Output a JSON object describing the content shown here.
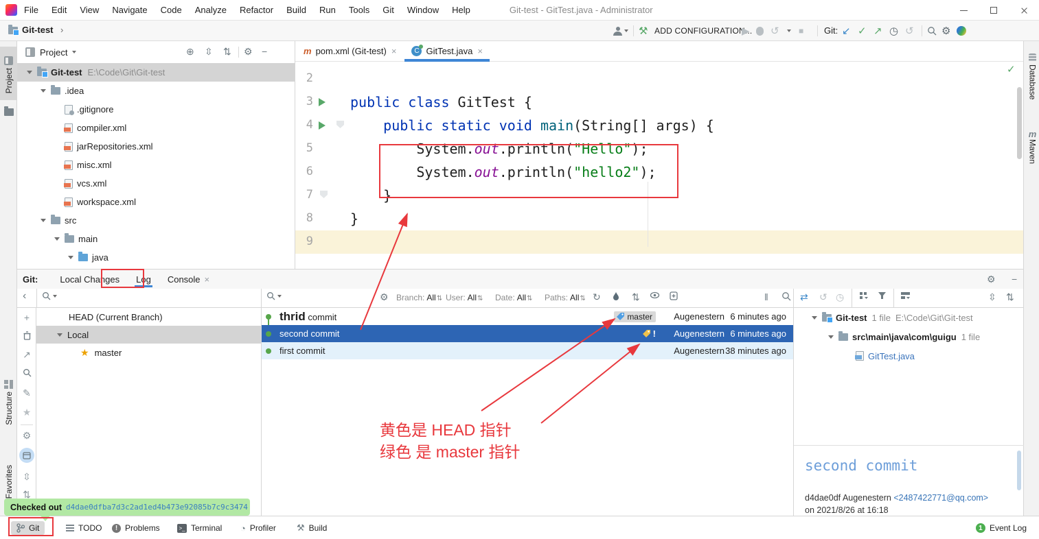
{
  "title_bar": {
    "menu": [
      "File",
      "Edit",
      "View",
      "Navigate",
      "Code",
      "Analyze",
      "Refactor",
      "Build",
      "Run",
      "Tools",
      "Git",
      "Window",
      "Help"
    ],
    "title": "Git-test - GitTest.java - Administrator"
  },
  "toolbar": {
    "breadcrumb": "Git-test",
    "breadcrumb_sep": "›",
    "add_configuration": "ADD CONFIGURATION...",
    "git_label": "Git:"
  },
  "stripes": {
    "project": "Project",
    "structure": "Structure",
    "favorites": "Favorites",
    "database": "Database",
    "maven": "Maven",
    "maven_glyph": "m"
  },
  "project_panel": {
    "header": "Project",
    "tree": [
      {
        "label": "Git-test",
        "suffix": "E:\\Code\\Git\\Git-test",
        "level": 0,
        "icon": "project",
        "caret": true,
        "bold": true,
        "selected": true
      },
      {
        "label": ".idea",
        "level": 1,
        "icon": "folder",
        "caret": true
      },
      {
        "label": ".gitignore",
        "level": 2,
        "icon": "ignored"
      },
      {
        "label": "compiler.xml",
        "level": 2,
        "icon": "xml"
      },
      {
        "label": "jarRepositories.xml",
        "level": 2,
        "icon": "xml"
      },
      {
        "label": "misc.xml",
        "level": 2,
        "icon": "xml"
      },
      {
        "label": "vcs.xml",
        "level": 2,
        "icon": "xml"
      },
      {
        "label": "workspace.xml",
        "level": 2,
        "icon": "xml"
      },
      {
        "label": "src",
        "level": 1,
        "icon": "folder",
        "caret": true
      },
      {
        "label": "main",
        "level": 2,
        "icon": "folder",
        "caret": true
      },
      {
        "label": "java",
        "level": 3,
        "icon": "folder-java",
        "caret": true
      }
    ]
  },
  "editor": {
    "tabs": [
      {
        "label": "pom.xml (Git-test)",
        "icon": "maven",
        "active": false
      },
      {
        "label": "GitTest.java",
        "icon": "class",
        "active": true
      }
    ],
    "lines": [
      {
        "n": "2",
        "tokens": []
      },
      {
        "n": "3",
        "run": true,
        "tokens": [
          {
            "t": "public class ",
            "c": "kw"
          },
          {
            "t": "GitTest {",
            "c": "pl"
          }
        ]
      },
      {
        "n": "4",
        "run": true,
        "fold": true,
        "tokens": [
          {
            "t": "    ",
            "c": "pl"
          },
          {
            "t": "public static void ",
            "c": "kw"
          },
          {
            "t": "main",
            "c": "mth"
          },
          {
            "t": "(String[] args) {",
            "c": "pl"
          }
        ]
      },
      {
        "n": "5",
        "tokens": [
          {
            "t": "        System.",
            "c": "pl"
          },
          {
            "t": "out",
            "c": "fld"
          },
          {
            "t": ".println(",
            "c": "pl"
          },
          {
            "t": "\"Hello\"",
            "c": "str"
          },
          {
            "t": ");",
            "c": "pl"
          }
        ]
      },
      {
        "n": "6",
        "tokens": [
          {
            "t": "        System.",
            "c": "pl"
          },
          {
            "t": "out",
            "c": "fld"
          },
          {
            "t": ".println(",
            "c": "pl"
          },
          {
            "t": "\"hello2\"",
            "c": "str"
          },
          {
            "t": ");",
            "c": "pl"
          }
        ]
      },
      {
        "n": "7",
        "fold2": true,
        "tokens": [
          {
            "t": "    }",
            "c": "pl"
          }
        ]
      },
      {
        "n": "8",
        "tokens": [
          {
            "t": "}",
            "c": "pl"
          }
        ]
      },
      {
        "n": "9",
        "hl": true,
        "tokens": []
      }
    ]
  },
  "git": {
    "label": "Git:",
    "tabs": [
      {
        "label": "Local Changes",
        "active": false
      },
      {
        "label": "Log",
        "active": true
      },
      {
        "label": "Console",
        "active": false,
        "closable": true
      }
    ],
    "filters": [
      {
        "label": "Branch:",
        "value": "All"
      },
      {
        "label": "User:",
        "value": "All"
      },
      {
        "label": "Date:",
        "value": "All"
      },
      {
        "label": "Paths:",
        "value": "All"
      }
    ],
    "branches": {
      "head": "HEAD (Current Branch)",
      "group": "Local",
      "items": [
        {
          "label": "master",
          "starred": true
        }
      ]
    },
    "commits": [
      {
        "emph": "thrid",
        "rest": " commit",
        "tag": "master",
        "author": "Augenestern",
        "time": "6 minutes ago",
        "selected": false
      },
      {
        "emph": "",
        "rest": "second commit",
        "head_tag": true,
        "author": "Augenestern",
        "time": "6 minutes ago",
        "selected": true
      },
      {
        "emph": "",
        "rest": "first commit",
        "author": "Augenestern",
        "time": "38 minutes ago",
        "selected": false,
        "recent": true
      }
    ],
    "files": {
      "root_name": "Git-test",
      "root_meta": "1 file",
      "root_path": "E:\\Code\\Git\\Git-test",
      "dir_name": "src\\main\\java\\com\\guigu",
      "dir_meta": "1 file",
      "file_name": "GitTest.java"
    },
    "details": {
      "title": "second commit",
      "hash": "d4dae0df",
      "author": "Augenestern",
      "email": "<2487422771@qq.com>",
      "date": "on 2021/8/26 at 16:18"
    }
  },
  "notification": {
    "prefix": "Checked out",
    "hash": "d4dae0dfba7d3c2ad1ed4b473e92085b7c9c3474"
  },
  "status_bar": {
    "items": [
      {
        "label": "Git",
        "icon": "git-branch",
        "active": true
      },
      {
        "label": "TODO",
        "icon": "todo-list",
        "active": false
      },
      {
        "label": "Problems",
        "icon": "problems",
        "active": false
      },
      {
        "label": "Terminal",
        "icon": "terminal",
        "active": false
      },
      {
        "label": "Profiler",
        "icon": "profiler",
        "active": false
      },
      {
        "label": "Build",
        "icon": "build-hammer",
        "active": false
      }
    ],
    "event_log": "Event Log",
    "event_badge": "1"
  },
  "annotations": {
    "head_note": "黄色是 HEAD 指针",
    "master_note": "绿色 是 master 指针"
  },
  "icons": {
    "gear": "⚙",
    "star": "★",
    "plus": "+",
    "minus": "−",
    "target": "⊕",
    "play": "▶",
    "stop": "■",
    "check": "✓",
    "arrow_dl": "↙",
    "arrow_ur": "↗",
    "clock": "◷",
    "undo": "↺",
    "refresh": "↻",
    "sort": "⇅",
    "pause": "‖",
    "chevron_left": "‹",
    "close": "×",
    "problem_mark": "!",
    "pencil": "✎",
    "swap": "⇄",
    "hammer_glyph": "⚒",
    "prompt": "›_",
    "profiler_glyph": "◔",
    "expand": "⇳",
    "collapse": "⇅"
  },
  "colors": {
    "annotation_red": "#e8383d",
    "selection_blue": "#2d65b4",
    "recent_row_blue": "#e3f1fb",
    "graph_green": "#57a64a",
    "notification_green": "#b2e8a4",
    "keyword_blue": "#0033b3",
    "string_green": "#067d17",
    "field_purple": "#871094",
    "tag_blue": "#4f9ee3",
    "tag_yellow": "#f0c24b"
  }
}
